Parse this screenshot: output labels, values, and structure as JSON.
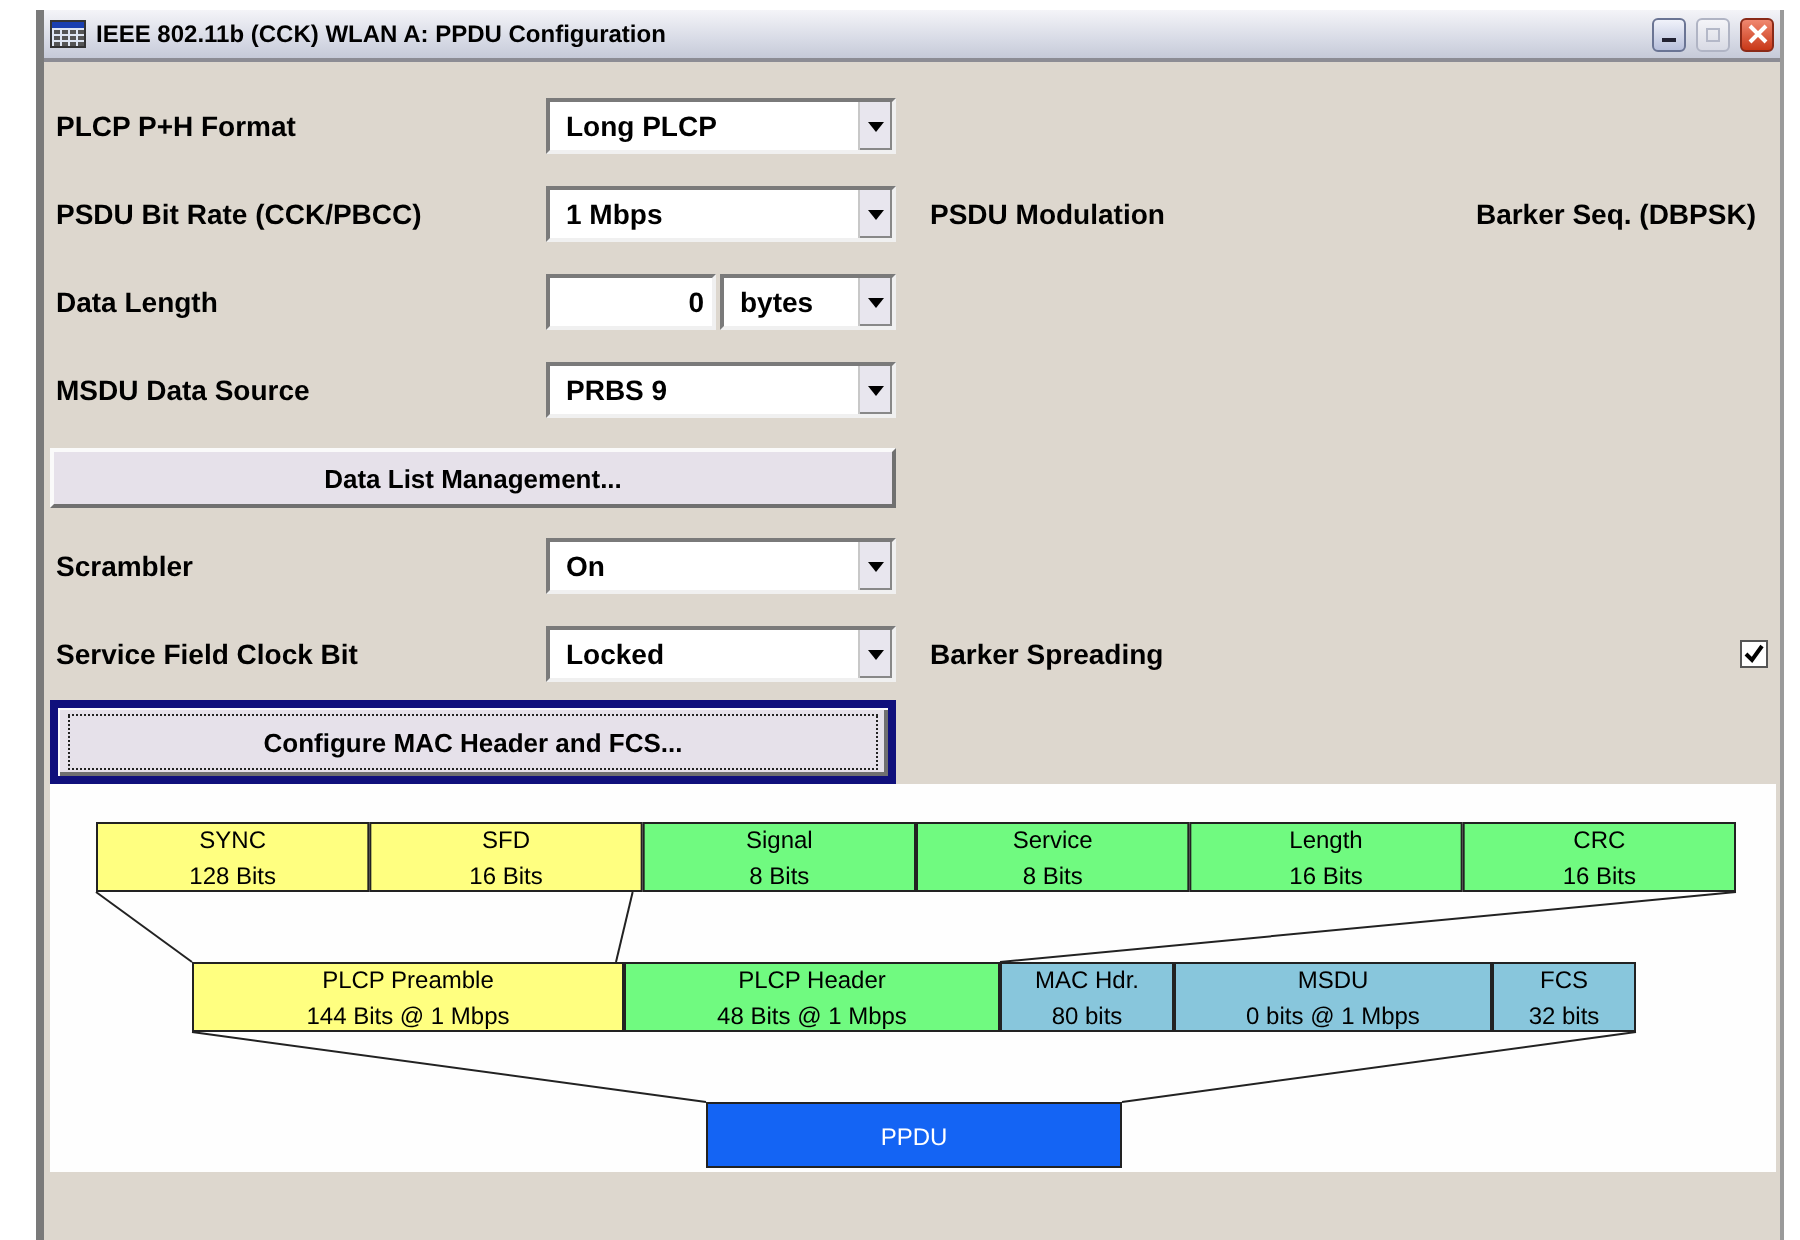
{
  "window": {
    "title": "IEEE 802.11b (CCK) WLAN A: PPDU Configuration"
  },
  "rows": [
    {
      "kind": "select",
      "label": "PLCP P+H Format",
      "value": "Long PLCP"
    },
    {
      "kind": "select",
      "label": "PSDU Bit Rate (CCK/PBCC)",
      "value": "1 Mbps",
      "info_label": "PSDU Modulation",
      "info_value": "Barker Seq. (DBPSK)"
    },
    {
      "kind": "number",
      "label": "Data Length",
      "value": "0",
      "unit": "bytes"
    },
    {
      "kind": "select",
      "label": "MSDU Data Source",
      "value": "PRBS 9"
    },
    {
      "kind": "button",
      "label": "Data List Management...",
      "focused": false
    },
    {
      "kind": "select",
      "label": "Scrambler",
      "value": "On"
    },
    {
      "kind": "select",
      "label": "Service Field Clock Bit",
      "value": "Locked",
      "check_label": "Barker Spreading",
      "checked": true
    },
    {
      "kind": "button",
      "label": "Configure MAC Header and FCS...",
      "focused": true
    }
  ],
  "diagram": {
    "top": [
      {
        "name": "SYNC",
        "size": "128 Bits",
        "color": "#ffff80"
      },
      {
        "name": "SFD",
        "size": "16 Bits",
        "color": "#ffff80"
      },
      {
        "name": "Signal",
        "size": "8 Bits",
        "color": "#70fa80"
      },
      {
        "name": "Service",
        "size": "8 Bits",
        "color": "#70fa80"
      },
      {
        "name": "Length",
        "size": "16 Bits",
        "color": "#70fa80"
      },
      {
        "name": "CRC",
        "size": "16 Bits",
        "color": "#70fa80"
      }
    ],
    "middle": [
      {
        "name": "PLCP Preamble",
        "size": "144 Bits @ 1 Mbps",
        "color": "#ffff80"
      },
      {
        "name": "PLCP Header",
        "size": "48 Bits @ 1 Mbps",
        "color": "#70fa80"
      },
      {
        "name": "MAC Hdr.",
        "size": "80 bits",
        "color": "#88c6dc"
      },
      {
        "name": "MSDU",
        "size": "0 bits @ 1 Mbps",
        "color": "#88c6dc"
      },
      {
        "name": "FCS",
        "size": "32 bits",
        "color": "#88c6dc"
      }
    ],
    "bottom": {
      "name": "PPDU",
      "color": "#1464f4"
    }
  }
}
